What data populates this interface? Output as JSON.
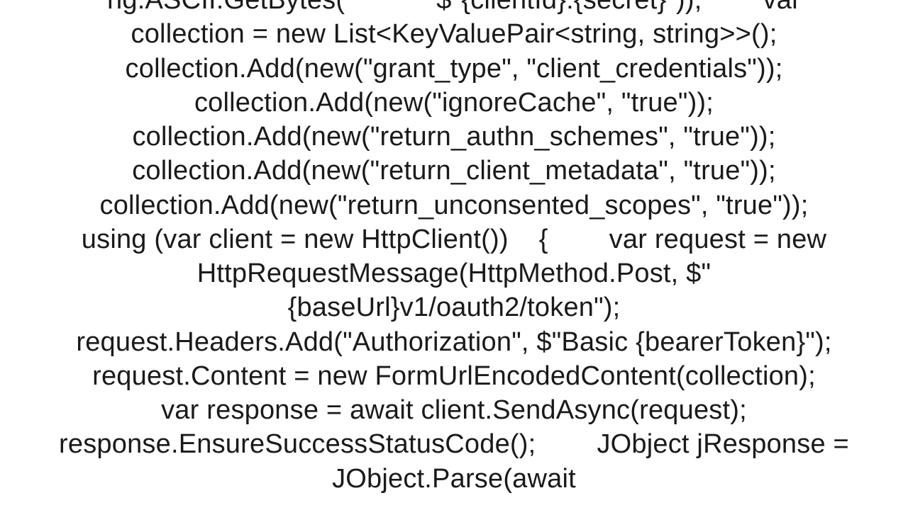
{
  "code": {
    "text": "ng.ASCII.GetBytes(            $\"{clientId}:{secret}\"));        var collection = new List<KeyValuePair<string, string>>();        collection.Add(new(\"grant_type\", \"client_credentials\"));        collection.Add(new(\"ignoreCache\", \"true\"));        collection.Add(new(\"return_authn_schemes\", \"true\"));        collection.Add(new(\"return_client_metadata\", \"true\"));        collection.Add(new(\"return_unconsented_scopes\", \"true\"));        using (var client = new HttpClient())    {        var request = new HttpRequestMessage(HttpMethod.Post, $\"{baseUrl}v1/oauth2/token\");        request.Headers.Add(\"Authorization\", $\"Basic {bearerToken}\");        request.Content = new FormUrlEncodedContent(collection);        var response = await client.SendAsync(request);        response.EnsureSuccessStatusCode();        JObject jResponse = JObject.Parse(await"
  }
}
